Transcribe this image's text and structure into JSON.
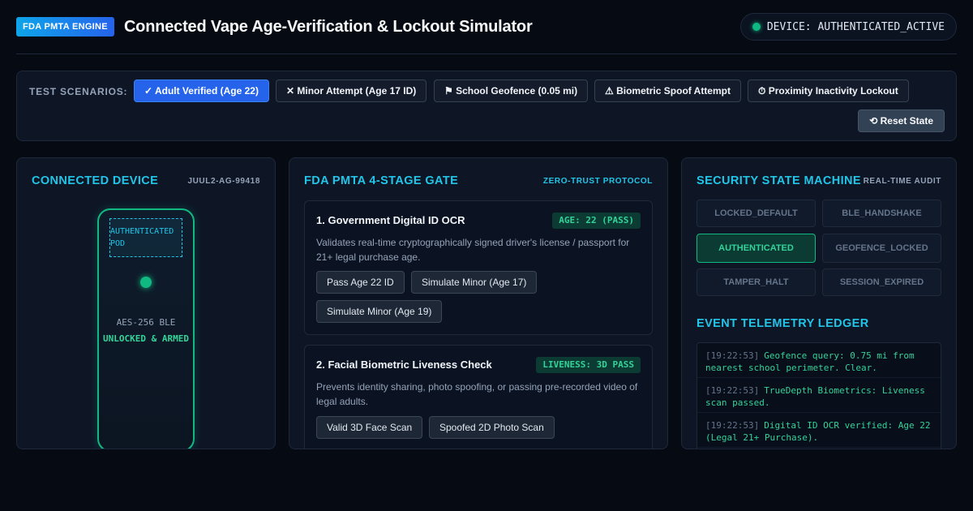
{
  "header": {
    "badge": "FDA PMTA ENGINE",
    "title": "Connected Vape Age-Verification & Lockout Simulator",
    "device_status": "DEVICE: AUTHENTICATED_ACTIVE",
    "status_color": "#10b981"
  },
  "scenarios": {
    "label": "TEST SCENARIOS:",
    "items": [
      {
        "label": "✓ Adult Verified (Age 22)",
        "active": true
      },
      {
        "label": "✕ Minor Attempt (Age 17 ID)",
        "active": false
      },
      {
        "label": "⚑ School Geofence (0.05 mi)",
        "active": false
      },
      {
        "label": "⚠ Biometric Spoof Attempt",
        "active": false
      },
      {
        "label": "⏱ Proximity Inactivity Lockout",
        "active": false
      }
    ],
    "reset": "⟲ Reset State"
  },
  "device": {
    "title": "CONNECTED DEVICE",
    "serial": "JUUL2-AG-99418",
    "pod_label_1": "AUTHENTICATED",
    "pod_label_2": "POD",
    "encryption": "AES-256 BLE",
    "state": "UNLOCKED & ARMED"
  },
  "gate": {
    "title": "FDA PMTA 4-STAGE GATE",
    "tag": "ZERO-TRUST PROTOCOL",
    "stages": [
      {
        "title": "1. Government Digital ID OCR",
        "badge": "AGE: 22 (PASS)",
        "desc": "Validates real-time cryptographically signed driver's license / passport for 21+ legal purchase age.",
        "buttons": [
          "Pass Age 22 ID",
          "Simulate Minor (Age 17)",
          "Simulate Minor (Age 19)"
        ]
      },
      {
        "title": "2. Facial Biometric Liveness Check",
        "badge": "LIVENESS: 3D PASS",
        "desc": "Prevents identity sharing, photo spoofing, or passing pre-recorded video of legal adults.",
        "buttons": [
          "Valid 3D Face Scan",
          "Spoofed 2D Photo Scan"
        ]
      }
    ]
  },
  "state_machine": {
    "title": "SECURITY STATE MACHINE",
    "tag": "REAL-TIME AUDIT",
    "states": [
      {
        "label": "LOCKED_DEFAULT",
        "active": false
      },
      {
        "label": "BLE_HANDSHAKE",
        "active": false
      },
      {
        "label": "AUTHENTICATED",
        "active": true
      },
      {
        "label": "GEOFENCE_LOCKED",
        "active": false
      },
      {
        "label": "TAMPER_HALT",
        "active": false
      },
      {
        "label": "SESSION_EXPIRED",
        "active": false
      }
    ]
  },
  "ledger": {
    "title": "EVENT TELEMETRY LEDGER",
    "entries": [
      {
        "time": "[19:22:53]",
        "text": "Geofence query: 0.75 mi from nearest school perimeter. Clear."
      },
      {
        "time": "[19:22:53]",
        "text": "TrueDepth Biometrics: Liveness scan passed."
      },
      {
        "time": "[19:22:53]",
        "text": "Digital ID OCR verified: Age 22 (Legal 21+ Purchase)."
      }
    ]
  },
  "colors": {
    "accent_cyan": "#22c5e8",
    "accent_green": "#10b981",
    "active_blue": "#2563eb"
  }
}
